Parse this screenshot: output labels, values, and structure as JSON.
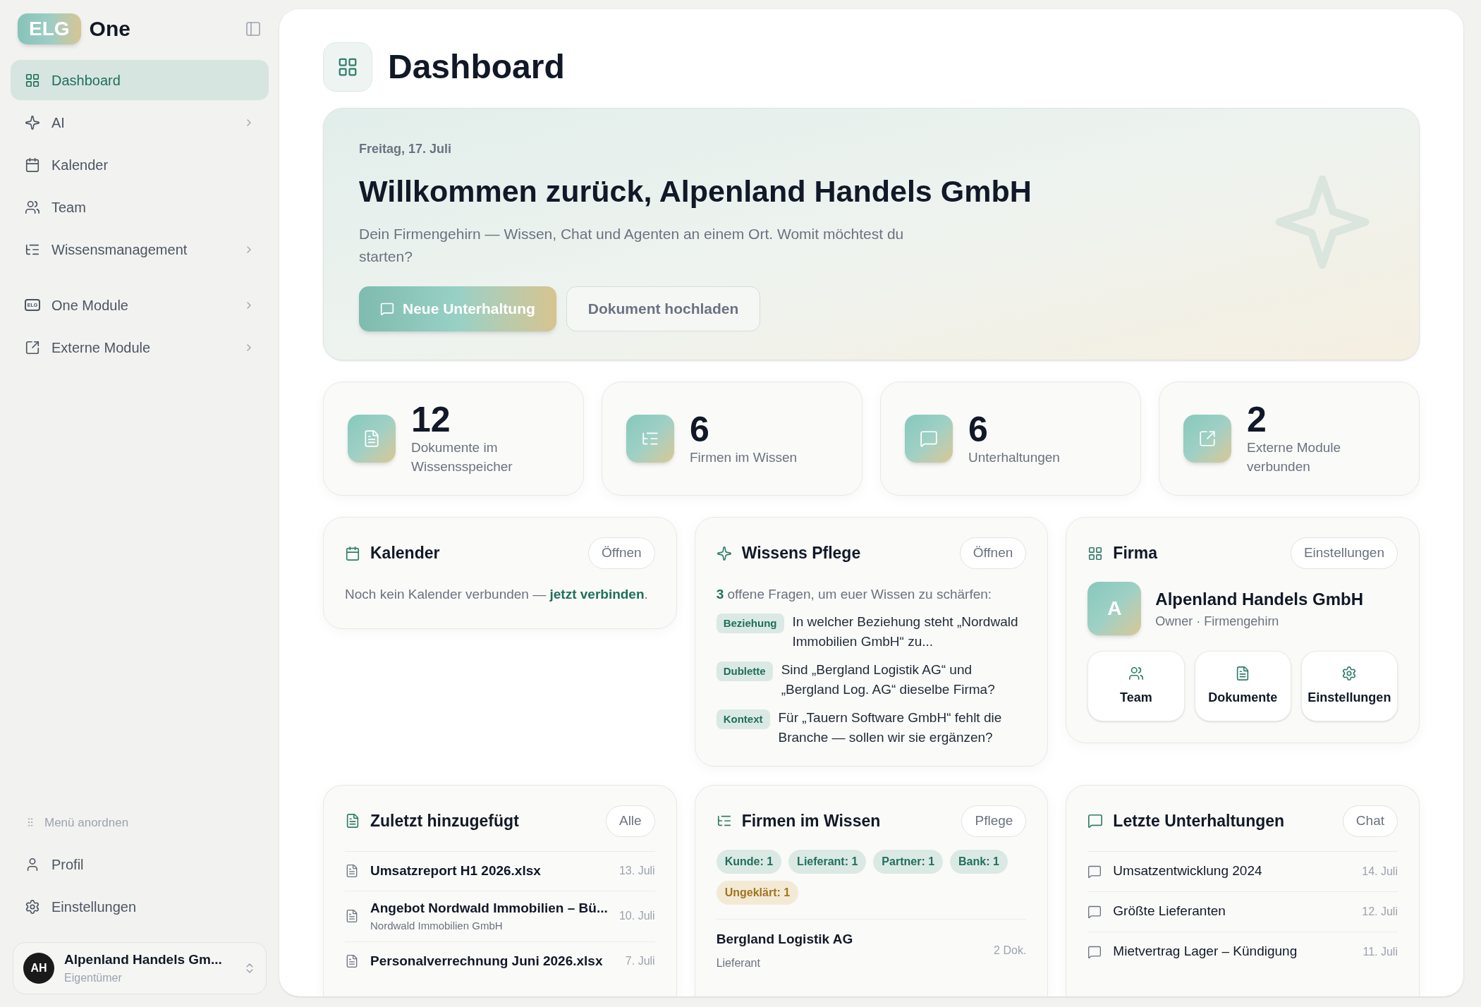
{
  "sidebar": {
    "logo": {
      "badge": "ELG",
      "name": "One"
    },
    "nav": [
      {
        "label": "Dashboard",
        "selected": true,
        "expandable": false
      },
      {
        "label": "AI",
        "selected": false,
        "expandable": true
      },
      {
        "label": "Kalender",
        "selected": false,
        "expandable": false
      },
      {
        "label": "Team",
        "selected": false,
        "expandable": false
      },
      {
        "label": "Wissensmanagement",
        "selected": false,
        "expandable": true
      }
    ],
    "modules": [
      {
        "label": "One Module",
        "icon_text": "ELG",
        "selected": false,
        "expandable": true
      },
      {
        "label": "Externe Module",
        "selected": false,
        "expandable": true
      }
    ],
    "arrange_label": "Menü anordnen",
    "footer_nav": [
      {
        "label": "Profil",
        "selected": false
      },
      {
        "label": "Einstellungen",
        "selected": false
      }
    ],
    "account": {
      "initials": "AH",
      "name": "Alpenland Handels Gm...",
      "role": "Eigentümer"
    }
  },
  "page": {
    "title": "Dashboard"
  },
  "hero": {
    "date": "Freitag, 17. Juli",
    "title": "Willkommen zurück, Alpenland Handels GmbH",
    "subtitle": "Dein Firmengehirn — Wissen, Chat und Agenten an einem Ort. Womit möchtest du starten?",
    "primary_button": "Neue Unterhaltung",
    "secondary_button": "Dokument hochladen"
  },
  "stats": [
    {
      "value": "12",
      "label": "Dokumente im Wissensspeicher"
    },
    {
      "value": "6",
      "label": "Firmen im Wissen"
    },
    {
      "value": "6",
      "label": "Unterhaltungen"
    },
    {
      "value": "2",
      "label": "Externe Module verbunden"
    }
  ],
  "calendar_card": {
    "title": "Kalender",
    "action": "Öffnen",
    "text": "Noch kein Kalender verbunden — ",
    "link": "jetzt verbinden",
    "end": "."
  },
  "knowledge_card": {
    "title": "Wissens Pflege",
    "action": "Öffnen",
    "intro": "**3** offene Fragen, um euer Wissen zu schärfen:",
    "questions": [
      {
        "tag": "Beziehung",
        "text": "In welcher Beziehung steht „Nordwald Immobilien GmbH“ zu..."
      },
      {
        "tag": "Dublette",
        "text": "Sind „Bergland Logistik AG“ und „Bergland Log. AG“ dieselbe Firma?"
      },
      {
        "tag": "Kontext",
        "text": "Für „Tauern Software GmbH“ fehlt die Branche — sollen wir sie ergänzen?"
      }
    ]
  },
  "company_card": {
    "title": "Firma",
    "action": "Einstellungen",
    "avatar": "A",
    "name": "Alpenland Handels GmbH",
    "subtitle": "Owner · Firmengehirn",
    "shortcuts": [
      "Team",
      "Dokumente",
      "Einstellungen"
    ]
  },
  "recent_card": {
    "title": "Zuletzt hinzugefügt",
    "action": "Alle",
    "rows": [
      {
        "name": "Umsatzreport H1 2026.xlsx",
        "date": "13. Juli"
      },
      {
        "name": "Angebot Nordwald Immobilien – Bü...",
        "sub": "Nordwald Immobilien GmbH",
        "date": "10. Juli"
      },
      {
        "name": "Personalverrechnung Juni 2026.xlsx",
        "date": "7. Juli"
      }
    ]
  },
  "companies_card": {
    "title": "Firmen im Wissen",
    "action": "Pflege",
    "tags": [
      {
        "label": "Kunde: 1",
        "kind": "known"
      },
      {
        "label": "Lieferant: 1",
        "kind": "known"
      },
      {
        "label": "Partner: 1",
        "kind": "known"
      },
      {
        "label": "Bank: 1",
        "kind": "known"
      },
      {
        "label": "Ungeklärt: 1",
        "kind": "open"
      }
    ],
    "rows": [
      {
        "name": "Bergland Logistik AG",
        "sub": "Lieferant",
        "count": "2 Dok."
      }
    ]
  },
  "chats_card": {
    "title": "Letzte Unterhaltungen",
    "action": "Chat",
    "rows": [
      {
        "name": "Umsatzentwicklung 2024",
        "date": "14. Juli"
      },
      {
        "name": "Größte Lieferanten",
        "date": "12. Juli"
      },
      {
        "name": "Mietvertrag Lager – Kündigung",
        "date": "11. Juli"
      }
    ]
  }
}
